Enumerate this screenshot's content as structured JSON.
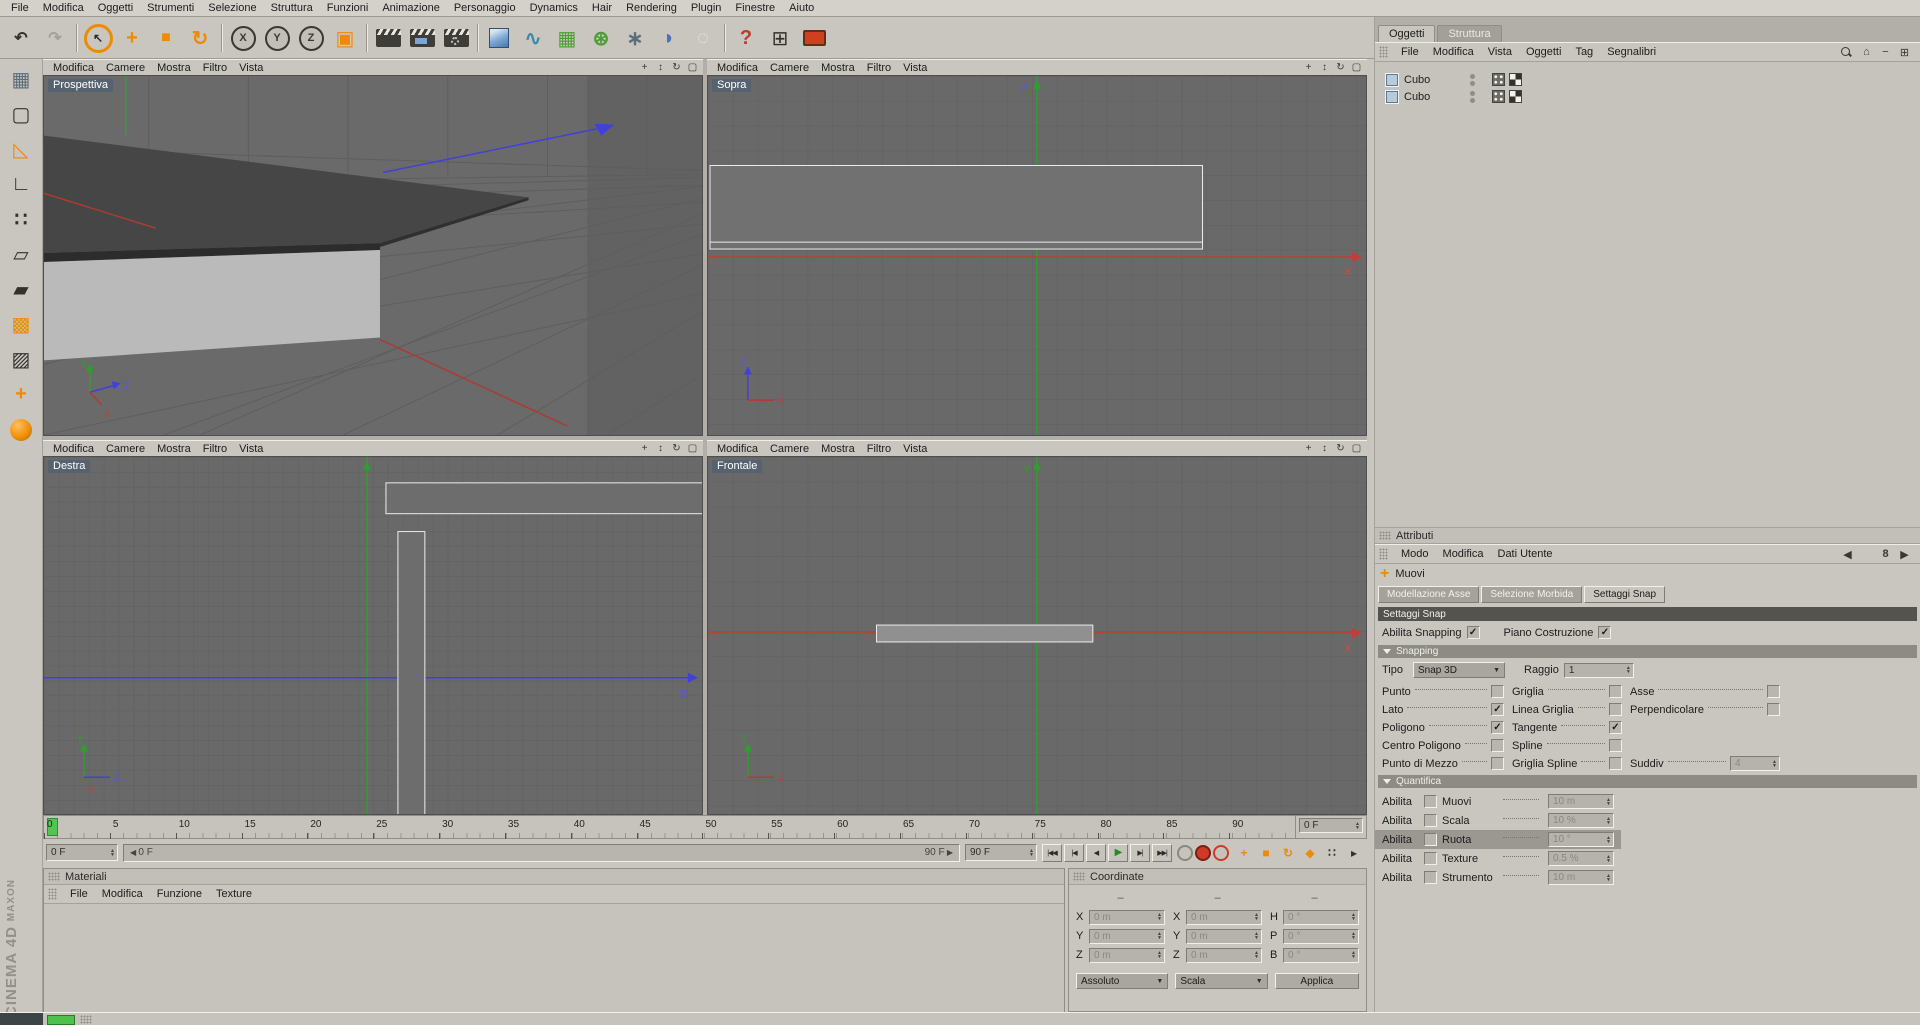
{
  "menubar": {
    "items": [
      "File",
      "Modifica",
      "Oggetti",
      "Strumenti",
      "Selezione",
      "Struttura",
      "Funzioni",
      "Animazione",
      "Personaggio",
      "Dynamics",
      "Hair",
      "Rendering",
      "Plugin",
      "Finestre",
      "Aiuto"
    ]
  },
  "toolbar": {
    "items": [
      {
        "name": "undo-icon",
        "glyph": "↶",
        "cls": "g-dark big bold"
      },
      {
        "name": "redo-icon",
        "glyph": "↷",
        "cls": "g-disabled big bold"
      },
      {
        "name": "separator",
        "sep": true
      },
      {
        "name": "live-selection-icon",
        "glyph": "↖",
        "cls": "sel-ring"
      },
      {
        "name": "move-icon",
        "glyph": "+",
        "cls": "g-orange huge bold"
      },
      {
        "name": "scale-icon",
        "glyph": "■",
        "cls": "g-orange big"
      },
      {
        "name": "rotate-icon",
        "glyph": "↻",
        "cls": "g-orange huge bold"
      },
      {
        "name": "separator",
        "sep": true
      },
      {
        "name": "lock-x-icon",
        "glyph": "X",
        "cls": "axis-circle"
      },
      {
        "name": "lock-y-icon",
        "glyph": "Y",
        "cls": "axis-circle"
      },
      {
        "name": "lock-z-icon",
        "glyph": "Z",
        "cls": "axis-circle"
      },
      {
        "name": "coord-system-icon",
        "glyph": "▣",
        "cls": "g-orange huge"
      },
      {
        "name": "separator",
        "sep": true
      },
      {
        "name": "render-view-icon",
        "cls": "clapper"
      },
      {
        "name": "render-picture-viewer-icon",
        "cls": "clapper dotted"
      },
      {
        "name": "render-settings-icon",
        "cls": "clapper gear"
      },
      {
        "name": "separator",
        "sep": true
      },
      {
        "name": "add-cube-icon",
        "cls": "cubeic"
      },
      {
        "name": "add-spline-icon",
        "glyph": "∿",
        "cls": "g-teal huge bold"
      },
      {
        "name": "add-generator-icon",
        "glyph": "▦",
        "cls": "g-green huge"
      },
      {
        "name": "add-modeling-icon",
        "glyph": "⊛",
        "cls": "g-green huge bold"
      },
      {
        "name": "add-particles-icon",
        "glyph": "∗",
        "cls": "g-slate huge bold"
      },
      {
        "name": "add-deformer-icon",
        "glyph": "◗",
        "cls": "g-blue huge"
      },
      {
        "name": "add-environment-icon",
        "glyph": "◌",
        "cls": "g-light huge bold"
      },
      {
        "name": "separator",
        "sep": true
      },
      {
        "name": "help-icon",
        "glyph": "?",
        "cls": "g-red huge bold"
      },
      {
        "name": "content-browser-icon",
        "glyph": "⊞",
        "cls": "g-dark huge"
      },
      {
        "name": "display-mode-icon",
        "cls": "screenic"
      }
    ]
  },
  "left_toolbar": {
    "items": [
      {
        "name": "make-editable-icon",
        "glyph": "▦",
        "cls": "g-slate huge"
      },
      {
        "name": "model-mode-icon",
        "glyph": "▢",
        "cls": "g-dark huge"
      },
      {
        "name": "texture-axis-icon",
        "glyph": "◺",
        "cls": "g-orange huge"
      },
      {
        "name": "workplane-icon",
        "glyph": "∟",
        "cls": "g-dark huge bold"
      },
      {
        "name": "points-mode-icon",
        "glyph": "∷",
        "cls": "g-dark huge bold"
      },
      {
        "name": "edges-mode-icon",
        "glyph": "▱",
        "cls": "g-dark huge"
      },
      {
        "name": "polygons-mode-icon",
        "glyph": "▰",
        "cls": "g-dark huge"
      },
      {
        "name": "animation-mode-icon",
        "glyph": "▩",
        "cls": "g-orange huge"
      },
      {
        "name": "texture-mode-icon",
        "glyph": "▨",
        "cls": "g-dark huge"
      },
      {
        "name": "object-axis-icon",
        "glyph": "+",
        "cls": "g-orange huge bold"
      },
      {
        "name": "viewport-solo-icon",
        "cls": "orangeball"
      }
    ]
  },
  "axis": {
    "x": "X",
    "y": "Y",
    "z": "Z"
  },
  "viewports": {
    "menus": [
      "Modifica",
      "Camere",
      "Mostra",
      "Filtro",
      "Vista"
    ],
    "controls": [
      {
        "name": "pan-view-icon",
        "glyph": "+"
      },
      {
        "name": "zoom-view-icon",
        "glyph": "↕"
      },
      {
        "name": "rotate-view-icon",
        "glyph": "↻"
      },
      {
        "name": "maximize-view-icon",
        "glyph": "▢"
      }
    ],
    "perspective_label": "Prospettiva",
    "top_label": "Sopra",
    "right_label": "Destra",
    "front_label": "Frontale"
  },
  "timeline": {
    "ticks": [
      "0",
      "5",
      "10",
      "15",
      "20",
      "25",
      "30",
      "35",
      "40",
      "45",
      "50",
      "55",
      "60",
      "65",
      "70",
      "75",
      "80",
      "85",
      "90"
    ],
    "frame_field": "0 F"
  },
  "transport": {
    "start_field": "0 F",
    "slider_left": "0 F",
    "slider_right": "90 F",
    "end_field": "90 F",
    "buttons": [
      {
        "name": "goto-start-button",
        "glyph": "|◀◀"
      },
      {
        "name": "prev-key-button",
        "glyph": "|◀"
      },
      {
        "name": "prev-frame-button",
        "glyph": "◀"
      },
      {
        "name": "play-button",
        "glyph": "▶",
        "cls": "play"
      },
      {
        "name": "next-frame-button",
        "glyph": "▶|"
      },
      {
        "name": "goto-end-button",
        "glyph": "▶▶|"
      }
    ],
    "records": [
      {
        "name": "record-snapshot-button",
        "cls": "ring"
      },
      {
        "name": "record-keyframe-button",
        "cls": "red"
      },
      {
        "name": "autokey-button",
        "cls": "ring-red"
      }
    ],
    "right_icons": [
      {
        "name": "record-position-icon",
        "glyph": "+",
        "cls": "g-orange bold"
      },
      {
        "name": "record-scale-icon",
        "glyph": "■",
        "cls": "g-orange"
      },
      {
        "name": "record-rotation-icon",
        "glyph": "↻",
        "cls": "g-orange bold"
      },
      {
        "name": "record-parameter-icon",
        "glyph": "◆",
        "cls": "g-orange"
      },
      {
        "name": "keyframe-selection-icon",
        "glyph": "∷",
        "cls": "g-dark bold"
      },
      {
        "name": "playback-options-icon",
        "glyph": "▸",
        "cls": "g-dark"
      }
    ]
  },
  "materials": {
    "title": "Materiali",
    "menus": [
      "File",
      "Modifica",
      "Funzione",
      "Texture"
    ]
  },
  "coordinates": {
    "title": "Coordinate",
    "cells": [
      {
        "header": "–"
      },
      {
        "header": "–"
      },
      {
        "header": "–"
      },
      {
        "label": "X",
        "value": "0 m"
      },
      {
        "label": "X",
        "value": "0 m"
      },
      {
        "label": "H",
        "value": "0 °"
      },
      {
        "label": "Y",
        "value": "0 m"
      },
      {
        "label": "Y",
        "value": "0 m"
      },
      {
        "label": "P",
        "value": "0 °"
      },
      {
        "label": "Z",
        "value": "0 m"
      },
      {
        "label": "Z",
        "value": "0 m"
      },
      {
        "label": "B",
        "value": "0 °"
      }
    ],
    "mode_position": "Assoluto",
    "mode_size": "Scala",
    "apply_label": "Applica"
  },
  "object_manager": {
    "tabs": [
      {
        "label": "Oggetti",
        "active": true
      },
      {
        "label": "Struttura",
        "active": false
      }
    ],
    "menus": [
      "File",
      "Modifica",
      "Vista",
      "Oggetti",
      "Tag",
      "Segnalibri"
    ],
    "icons": [
      {
        "name": "search-icon",
        "cls": "searchic"
      },
      {
        "name": "home-icon",
        "glyph": "⌂"
      },
      {
        "name": "collapse-icon",
        "glyph": "−"
      },
      {
        "name": "expand-icon",
        "glyph": "⊞"
      }
    ],
    "objects": [
      {
        "name": "Cubo"
      },
      {
        "name": "Cubo"
      }
    ]
  },
  "attributes": {
    "title": "Attributi",
    "menus": [
      "Modo",
      "Modifica",
      "Dati Utente"
    ],
    "nav_icons": [
      {
        "name": "history-back-icon",
        "glyph": "◀",
        "cls": "g-dark"
      },
      {
        "name": "lock-icon",
        "glyph": "",
        "cls": "lockic"
      },
      {
        "name": "link-icon",
        "glyph": "8",
        "cls": "g-dark bold"
      },
      {
        "name": "history-forward-icon",
        "glyph": "▶",
        "cls": "g-dark"
      }
    ],
    "tool_name": "Muovi",
    "tabs": [
      {
        "label": "Modellazione Asse",
        "active": false
      },
      {
        "label": "Selezione Morbida",
        "active": false
      },
      {
        "label": "Settaggi Snap",
        "active": true
      }
    ],
    "section_title": "Settaggi Snap",
    "enable_snapping_label": "Abilita Snapping",
    "construction_plane_label": "Piano Costruzione",
    "snapping_group_title": "Snapping",
    "tipo_label": "Tipo",
    "tipo_value": "Snap 3D",
    "raggio_label": "Raggio",
    "raggio_value": "1",
    "snap_cells": [
      {
        "label": "Punto",
        "checked": false
      },
      {
        "label": "Griglia",
        "checked": false
      },
      {
        "label": "Asse",
        "checked": false
      },
      {
        "label": "Lato",
        "checked": true
      },
      {
        "label": "Linea Griglia",
        "checked": false
      },
      {
        "label": "Perpendicolare",
        "checked": false
      },
      {
        "label": "Poligono",
        "checked": true
      },
      {
        "label": "Tangente",
        "checked": true
      },
      {
        "blank": true
      },
      {
        "label": "Centro Poligono",
        "checked": false
      },
      {
        "label": "Spline",
        "checked": false
      },
      {
        "blank": true
      },
      {
        "label": "Punto di Mezzo",
        "checked": false
      },
      {
        "label": "Griglia Spline",
        "checked": false
      },
      {
        "label": "Suddiv",
        "field": true,
        "value": "4"
      }
    ],
    "quantify_group_title": "Quantifica",
    "quant_rows": [
      {
        "enable_label": "Abilita",
        "checked": false,
        "field_label": "Muovi",
        "value": "10 m",
        "selected": false
      },
      {
        "enable_label": "Abilita",
        "checked": false,
        "field_label": "Scala",
        "value": "10 %",
        "selected": false
      },
      {
        "enable_label": "Abilita",
        "checked": false,
        "field_label": "Ruota",
        "value": "10 °",
        "selected": true
      },
      {
        "enable_label": "Abilita",
        "checked": false,
        "field_label": "Texture",
        "value": "0.5 %",
        "selected": false
      },
      {
        "enable_label": "Abilita",
        "checked": false,
        "field_label": "Strumento",
        "value": "10 m",
        "selected": false
      }
    ]
  },
  "branding": {
    "company": "MAXON",
    "product": "CINEMA 4D"
  }
}
